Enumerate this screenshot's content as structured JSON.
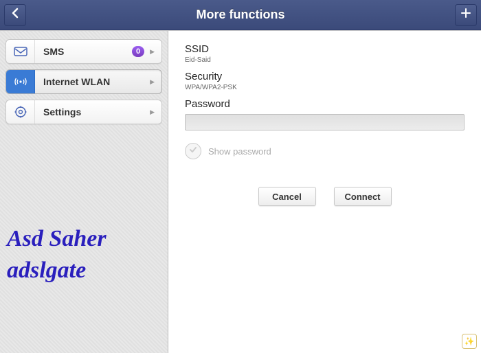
{
  "header": {
    "title": "More functions"
  },
  "sidebar": {
    "items": [
      {
        "label": "SMS",
        "badge": "0"
      },
      {
        "label": "Internet WLAN"
      },
      {
        "label": "Settings"
      }
    ],
    "watermark": "Asd Saher\nadslgate"
  },
  "content": {
    "ssid_label": "SSID",
    "ssid_value": "Eid-Said",
    "security_label": "Security",
    "security_value": "WPA/WPA2-PSK",
    "password_label": "Password",
    "password_value": "",
    "show_password_label": "Show password",
    "cancel_label": "Cancel",
    "connect_label": "Connect"
  }
}
